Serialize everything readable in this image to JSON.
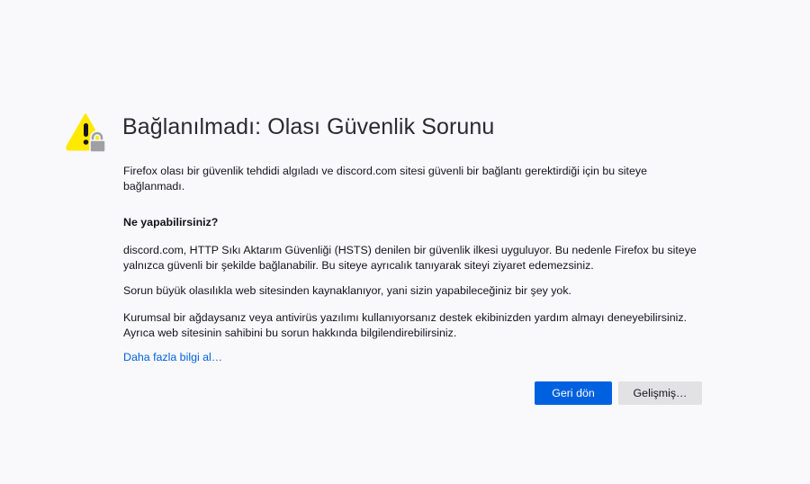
{
  "title": "Bağlanılmadı: Olası Güvenlik Sorunu",
  "intro": "Firefox olası bir güvenlik tehdidi algıladı ve discord.com sitesi güvenli bir bağlantı gerektirdiği için bu siteye bağlanmadı.",
  "what_heading": "Ne yapabilirsiniz?",
  "paragraphs": [
    "discord.com, HTTP Sıkı Aktarım Güvenliği (HSTS) denilen bir güvenlik ilkesi uyguluyor. Bu nedenle Firefox bu siteye yalnızca güvenli bir şekilde bağlanabilir. Bu siteye ayrıcalık tanıyarak siteyi ziyaret edemezsiniz.",
    "Sorun büyük olasılıkla web sitesinden kaynaklanıyor, yani sizin yapabileceğiniz bir şey yok.",
    "Kurumsal bir ağdaysanız veya antivirüs yazılımı kullanıyorsanız destek ekibinizden yardım almayı deneyebilirsiniz. Ayrıca web sitesinin sahibini bu sorun hakkında bilgilendirebilirsiniz."
  ],
  "learn_more": "Daha fazla bilgi al…",
  "buttons": {
    "back": "Geri dön",
    "advanced": "Gelişmiş…"
  },
  "icon": "warning-lock-icon",
  "colors": {
    "accent": "#0061e0",
    "warning": "#ffe900"
  }
}
